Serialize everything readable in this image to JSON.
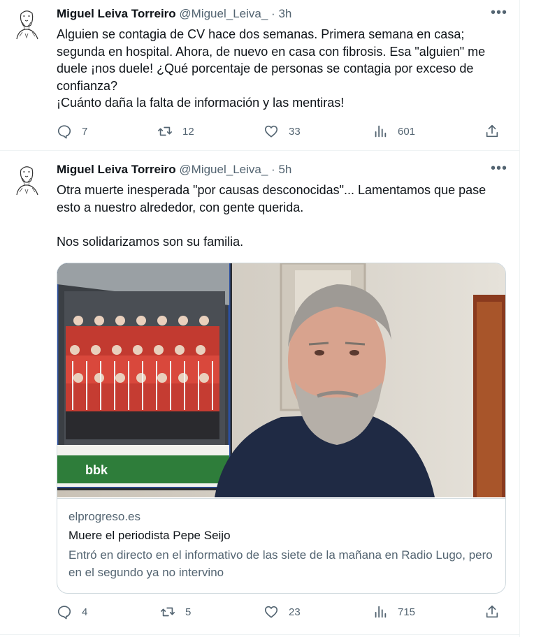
{
  "colors": {
    "text": "#0f1419",
    "secondary": "#536471",
    "border": "#cfd9de"
  },
  "tweets": [
    {
      "author_name": "Miguel Leiva Torreiro",
      "handle": "@Miguel_Leiva_",
      "separator": "·",
      "time": "3h",
      "text_lines": [
        "Alguien se contagia de CV hace dos semanas. Primera semana en casa; segunda en hospital. Ahora, de nuevo en casa con fibrosis. Esa \"alguien\" me duele ¡nos duele! ¿Qué porcentaje de personas se contagia por exceso de confianza?",
        "¡Cuánto daña la falta de información y las mentiras!"
      ],
      "replies": "7",
      "retweets": "12",
      "likes": "33",
      "views": "601"
    },
    {
      "author_name": "Miguel Leiva Torreiro",
      "handle": "@Miguel_Leiva_",
      "separator": "·",
      "time": "5h",
      "text_lines": [
        "Otra muerte inesperada \"por causas desconocidas\"... Lamentamos que pase esto a nuestro alrededor, con gente querida.",
        "Nos solidarizamos son su familia."
      ],
      "card": {
        "domain": "elprogreso.es",
        "title": "Muere el periodista Pepe Seijo",
        "description": "Entró en directo en el informativo de las siete de la mañana en Radio Lugo, pero en el segundo ya no intervino",
        "poster_logo": "bbk"
      },
      "replies": "4",
      "retweets": "5",
      "likes": "23",
      "views": "715"
    }
  ],
  "icons": {
    "avatar": "sketch-portrait-icon",
    "more": "more-options-icon",
    "reply": "reply-icon",
    "retweet": "retweet-icon",
    "like": "heart-icon",
    "views": "views-chart-icon",
    "share": "share-icon"
  }
}
